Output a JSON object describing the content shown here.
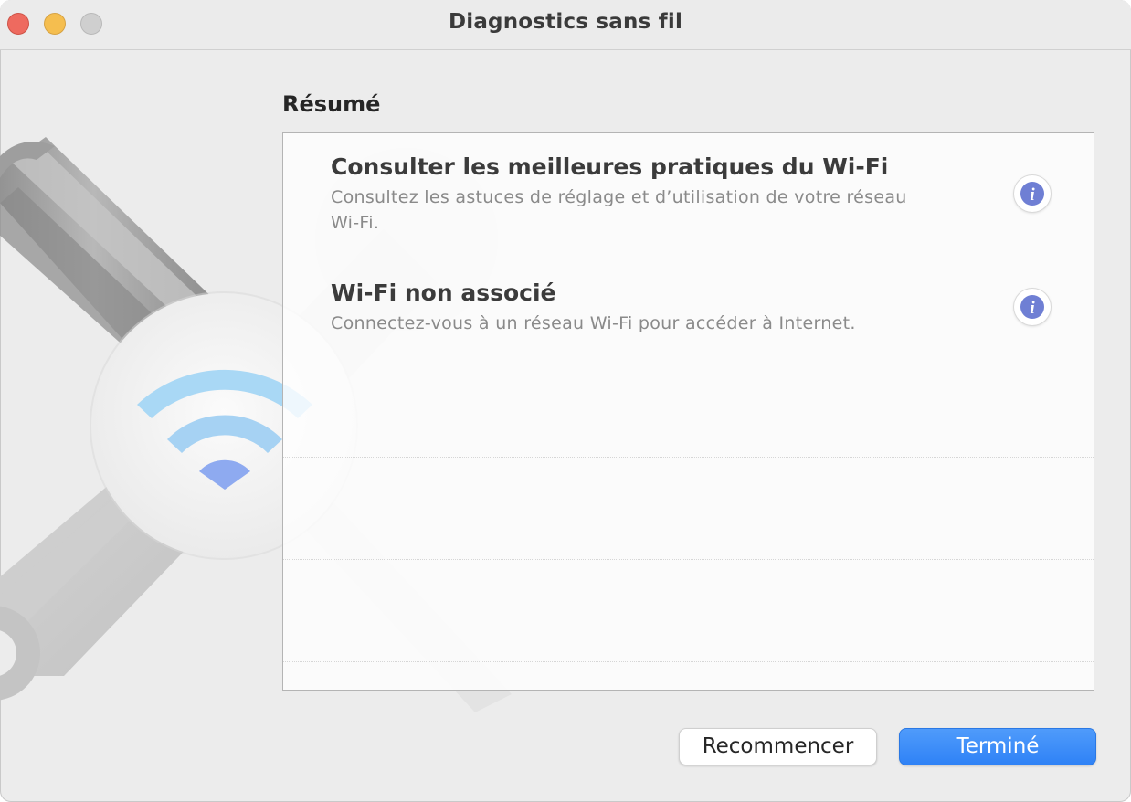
{
  "window": {
    "title": "Diagnostics sans fil"
  },
  "summary": {
    "heading": "Résumé",
    "items": [
      {
        "title": "Consulter les meilleures pratiques du Wi-Fi",
        "description_line1": "Consultez les astuces de réglage et d’utilisation de votre réseau",
        "description_line2": "Wi-Fi.",
        "icon": "info-icon"
      },
      {
        "title": "Wi-Fi non associé",
        "description_line1": "Connectez-vous à un réseau Wi-Fi pour accéder à Internet.",
        "icon": "info-icon"
      }
    ]
  },
  "buttons": {
    "restart_label": "Recommencer",
    "done_label": "Terminé"
  },
  "colors": {
    "accent": "#3586f7",
    "info_icon": "#6f7fd4",
    "wifi_light": "#a9d8f5",
    "wifi_dot": "#8eaaf0"
  }
}
